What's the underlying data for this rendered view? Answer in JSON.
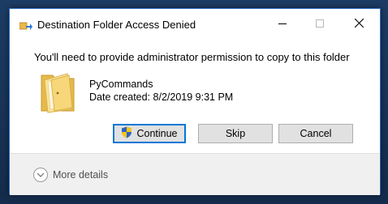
{
  "window": {
    "title": "Destination Folder Access Denied",
    "minimize_icon": "minimize-icon",
    "maximize_icon": "maximize-icon",
    "close_icon": "close-icon"
  },
  "message": "You'll need to provide administrator permission to copy to this folder",
  "item": {
    "icon": "folder-icon",
    "name": "PyCommands",
    "date_created": "Date created: 8/2/2019 9:31 PM"
  },
  "buttons": {
    "continue_label": "Continue",
    "continue_icon": "uac-shield-icon",
    "skip_label": "Skip",
    "cancel_label": "Cancel"
  },
  "footer": {
    "more_details_label": "More details",
    "more_details_icon": "chevron-down-icon"
  },
  "colors": {
    "window_border": "#2b6cc4",
    "focus_border": "#0078d7",
    "button_bg": "#e1e1e1",
    "footer_bg": "#f0f0f0"
  }
}
